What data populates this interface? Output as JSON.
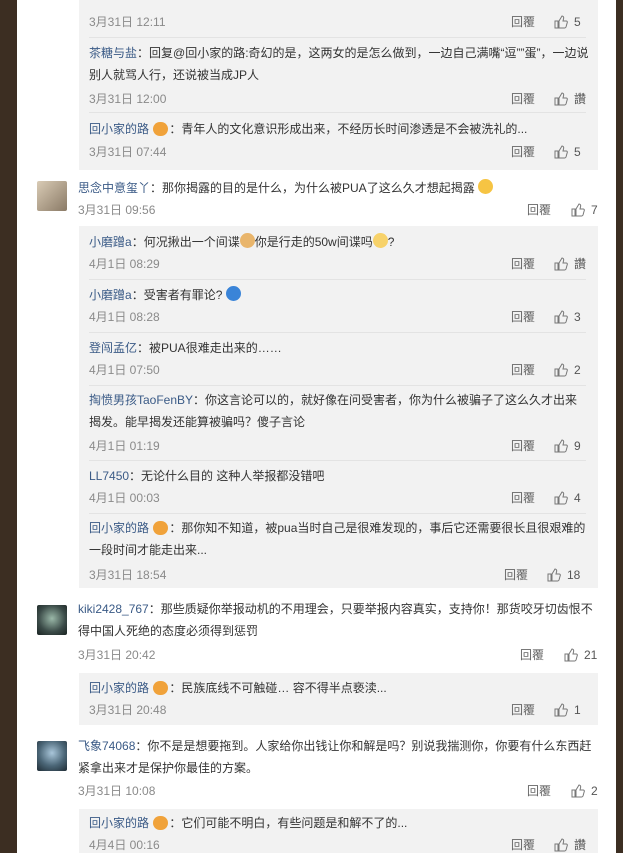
{
  "colors": {
    "username": "#3a5a86",
    "time": "#8a8a8a",
    "reply_bg": "#f2f2f2",
    "frame": "#3c2e22"
  },
  "actions": {
    "reply_label": "回覆",
    "like_label": "讚"
  },
  "comments": {
    "r0": {
      "time": "3月31日 12:11",
      "likes": "5"
    },
    "r1": {
      "user": "茶糖与盐",
      "text": "：回复@回小家的路:奇幻的是，这两女的是怎么做到，一边自己满嘴“逗””蛋”，一边说别人就骂人行，还说被当成JP人",
      "time": "3月31日 12:00",
      "likes": "讚"
    },
    "r2": {
      "user": "回小家的路",
      "text": "：青年人的文化意识形成出来，不经历长时间渗透是不会被洗礼的...",
      "time": "3月31日 07:44",
      "likes": "5"
    },
    "c1": {
      "user": "思念中意玺丫",
      "text": "：那你揭露的目的是什么，为什么被PUA了这么久才想起揭露",
      "time": "3月31日 09:56",
      "likes": "7"
    },
    "c1r1": {
      "user": "小磨蹭a",
      "text": "：何况揪出一个间谍",
      "text2": "你是行走的50w间谍吗",
      "text3": "?",
      "time": "4月1日 08:29",
      "likes": "讚"
    },
    "c1r2": {
      "user": "小磨蹭a",
      "text": "：受害者有罪论?",
      "time": "4月1日 08:28",
      "likes": "3"
    },
    "c1r3": {
      "user": "登闯孟亿",
      "text": "：被PUA很难走出来的……",
      "time": "4月1日 07:50",
      "likes": "2"
    },
    "c1r4": {
      "user": "掏愤男孩TaoFenBY",
      "text": "：你这言论可以的，就好像在问受害者，你为什么被骗子了这么久才出来揭发。能早揭发还能算被骗吗？傻子言论",
      "time": "4月1日 01:19",
      "likes": "9"
    },
    "c1r5": {
      "user": "LL7450",
      "text": "：无论什么目的 这种人举报都没错吧",
      "time": "4月1日 00:03",
      "likes": "4"
    },
    "c1r6": {
      "user": "回小家的路",
      "text": "：那你知不知道，被pua当时自己是很难发现的，事后它还需要很长且很艰难的一段时间才能走出来...",
      "time": "3月31日 18:54",
      "likes": "18"
    },
    "c2": {
      "user": "kiki2428_767",
      "text": "：那些质疑你举报动机的不用理会，只要举报内容真实，支持你！那货咬牙切齿恨不得中国人死绝的态度必须得到惩罚",
      "time": "3月31日 20:42",
      "likes": "21"
    },
    "c2r1": {
      "user": "回小家的路",
      "text": "：民族底线不可触碰… 容不得半点亵渎...",
      "time": "3月31日 20:48",
      "likes": "1"
    },
    "c3": {
      "user": "飞象74068",
      "text": "：你不是是想要拖到。人家给你出钱让你和解是吗？别说我揣测你，你要有什么东西赶紧拿出来才是保护你最佳的方案。",
      "time": "3月31日 10:08",
      "likes": "2"
    },
    "c3r1": {
      "user": "回小家的路",
      "text": "：它们可能不明白，有些问题是和解不了的...",
      "time": "4月4日 00:16",
      "likes": "讚"
    }
  }
}
